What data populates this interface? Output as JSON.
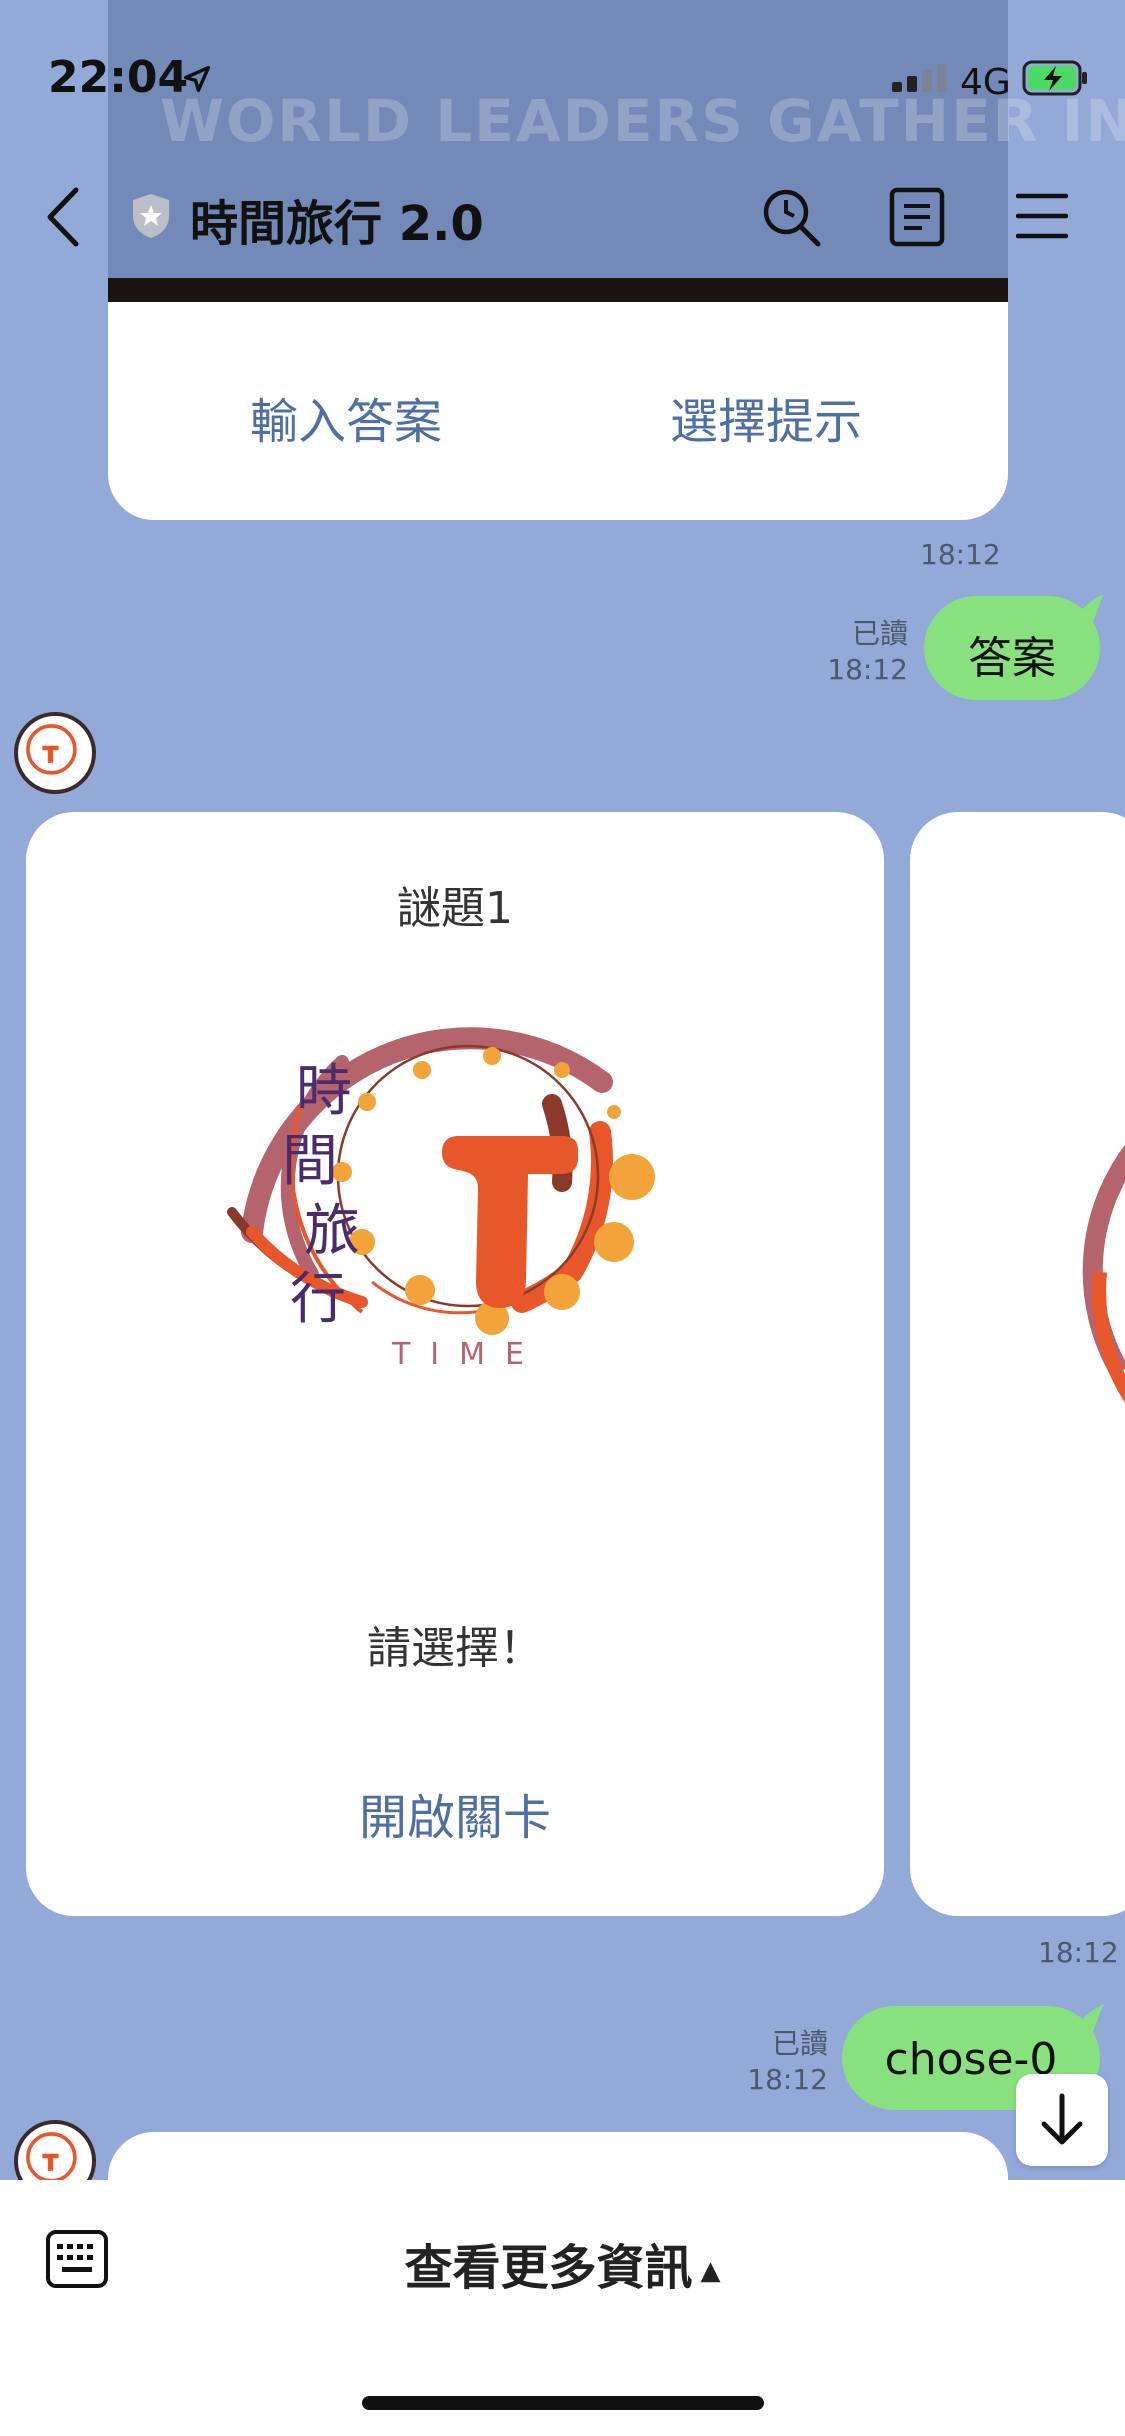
{
  "status_bar": {
    "time": "22:04",
    "network": "4G"
  },
  "header": {
    "title": "時間旅行 2.0"
  },
  "top_card": {
    "headline": "WORLD LEADERS GATHER IN QUEBEC",
    "actions": [
      "輸入答案",
      "選擇提示"
    ],
    "timestamp": "18:12"
  },
  "messages": [
    {
      "read_label": "已讀",
      "time": "18:12",
      "text": "答案"
    },
    {
      "read_label": "已讀",
      "time": "18:12",
      "text": "chose-0"
    }
  ],
  "card": {
    "title": "謎題1",
    "logo_text": [
      "時",
      "間",
      "旅",
      "行"
    ],
    "logo_caption": "TIME",
    "prompt": "請選擇！",
    "action": "開啟關卡",
    "timestamp": "18:12"
  },
  "bottom_bar": {
    "label": "查看更多資訊",
    "arrow": "▲"
  },
  "colors": {
    "background": "#93a9d8",
    "bubble": "#88e07e",
    "link": "#4d6fa3",
    "logo_orange": "#e8572a",
    "logo_mauve": "#b5646e",
    "logo_dot": "#f2a33a",
    "logo_text": "#4a2c6e"
  }
}
